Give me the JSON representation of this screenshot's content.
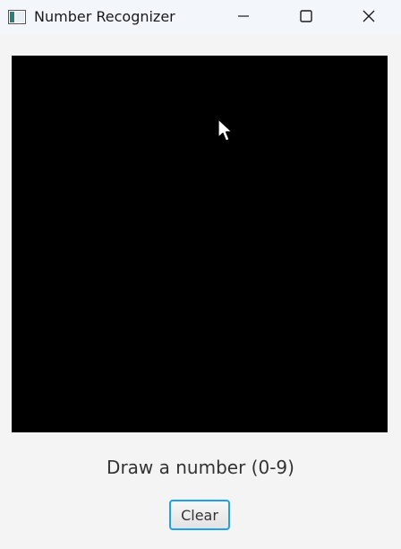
{
  "window": {
    "title": "Number Recognizer",
    "icons": {
      "app": "java-app-icon",
      "minimize": "minimize-icon",
      "maximize": "maximize-icon",
      "close": "close-icon"
    }
  },
  "canvas": {
    "background": "#000000",
    "cursor_icon": "arrow-cursor-icon"
  },
  "prompt": {
    "text": "Draw a number (0-9)"
  },
  "actions": {
    "clear_label": "Clear",
    "accent": "#1fa1e6"
  }
}
